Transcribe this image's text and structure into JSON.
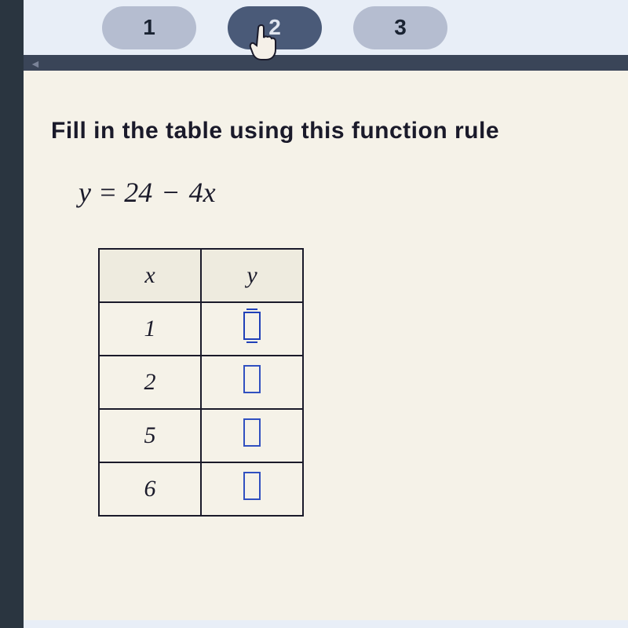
{
  "nav": {
    "items": [
      "1",
      "2",
      "3"
    ],
    "active_index": 1
  },
  "instruction": "Fill in the table using this function rule",
  "equation": {
    "lhs": "y",
    "rhs_const": "24",
    "rhs_coef": "4",
    "rhs_var": "x"
  },
  "table": {
    "headers": [
      "x",
      "y"
    ],
    "rows": [
      {
        "x": "1",
        "y": "",
        "active": true
      },
      {
        "x": "2",
        "y": "",
        "active": false
      },
      {
        "x": "5",
        "y": "",
        "active": false
      },
      {
        "x": "6",
        "y": "",
        "active": false
      }
    ]
  }
}
